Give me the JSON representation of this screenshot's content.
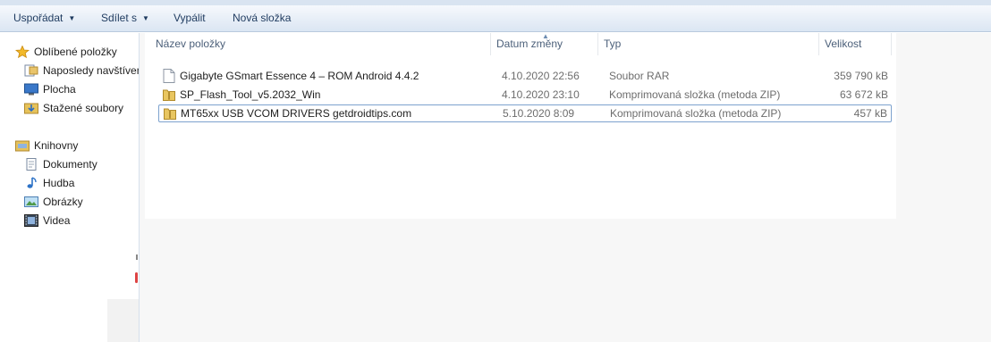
{
  "toolbar": {
    "organize": "Uspořádat",
    "share": "Sdílet s",
    "burn": "Vypálit",
    "new_folder": "Nová složka"
  },
  "nav": {
    "favorites": {
      "title": "Oblíbené položky",
      "items": [
        "Naposledy navštívené",
        "Plocha",
        "Stažené soubory"
      ]
    },
    "libraries": {
      "title": "Knihovny",
      "items": [
        "Dokumenty",
        "Hudba",
        "Obrázky",
        "Videa"
      ]
    }
  },
  "columns": {
    "name": "Název položky",
    "date": "Datum změny",
    "type": "Typ",
    "size": "Velikost"
  },
  "files": [
    {
      "name": "Gigabyte GSmart Essence 4 – ROM Android 4.4.2",
      "date": "4.10.2020 22:56",
      "type": "Soubor RAR",
      "size": "359 790 kB",
      "icon": "file-icon"
    },
    {
      "name": "SP_Flash_Tool_v5.2032_Win",
      "date": "4.10.2020 23:10",
      "type": "Komprimovaná složka (metoda ZIP)",
      "size": "63 672 kB",
      "icon": "zip-folder-icon"
    },
    {
      "name": "MT65xx USB VCOM DRIVERS getdroidtips.com",
      "date": "5.10.2020 8:09",
      "type": "Komprimovaná složka (metoda ZIP)",
      "size": "457 kB",
      "icon": "zip-folder-icon",
      "selected": true
    }
  ],
  "colors": {
    "toolbar_text": "#1e3a5f",
    "header_text": "#4c607a",
    "selection_border": "#7da2ce"
  }
}
